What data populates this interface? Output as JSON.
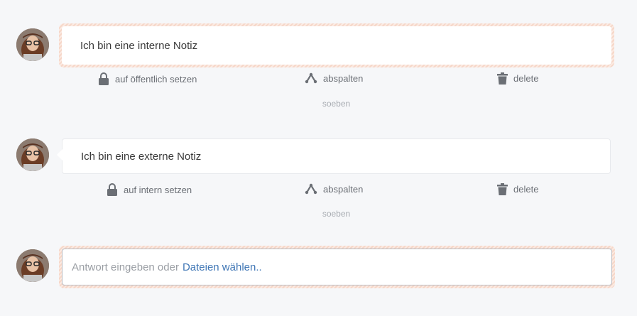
{
  "articles": [
    {
      "text": "Ich bin eine interne Notiz",
      "internal": true,
      "actions": {
        "visibility_label": "auf öffentlich setzen",
        "split_label": "abspalten",
        "delete_label": "delete"
      },
      "timestamp": "soeben"
    },
    {
      "text": "Ich bin eine externe Notiz",
      "internal": false,
      "actions": {
        "visibility_label": "auf intern setzen",
        "split_label": "abspalten",
        "delete_label": "delete"
      },
      "timestamp": "soeben"
    }
  ],
  "reply": {
    "placeholder": "Antwort eingeben oder",
    "link_label": "Dateien wählen.."
  },
  "icons": {
    "visibility": "lock-icon",
    "split": "split-icon",
    "delete": "trash-icon",
    "avatar": "user-avatar"
  },
  "colors": {
    "internal_stripe": "#f6d7c9",
    "link": "#3f76b5",
    "action_text": "#6b6f75",
    "timestamp": "#a8acb2"
  }
}
